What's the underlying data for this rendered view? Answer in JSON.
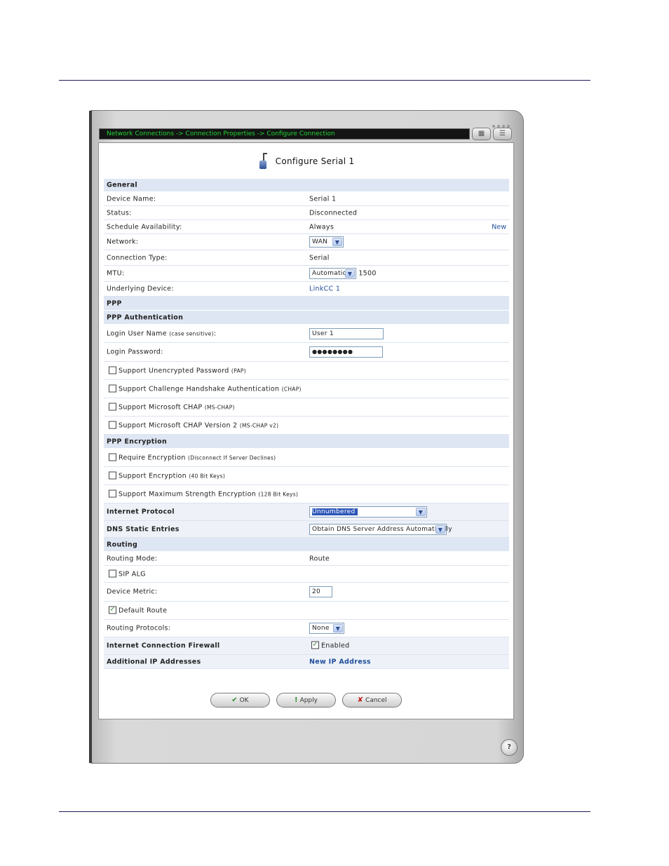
{
  "breadcrumb": "Network Connections -> Connection Properties -> Configure Connection",
  "title": "Configure Serial 1",
  "sections": {
    "general": "General",
    "ppp": "PPP",
    "ppp_auth": "PPP Authentication",
    "ppp_enc": "PPP Encryption",
    "routing": "Routing"
  },
  "general": {
    "device_name_label": "Device Name:",
    "device_name_value": "Serial 1",
    "status_label": "Status:",
    "status_value": "Disconnected",
    "schedule_label": "Schedule Availability:",
    "schedule_value": "Always",
    "schedule_new": "New",
    "network_label": "Network:",
    "network_value": "WAN",
    "conn_type_label": "Connection Type:",
    "conn_type_value": "Serial",
    "mtu_label": "MTU:",
    "mtu_mode": "Automatic",
    "mtu_value": "1500",
    "underlying_label": "Underlying Device:",
    "underlying_value": "LinkCC 1"
  },
  "auth": {
    "login_user_label": "Login User Name",
    "login_user_hint": "(case sensitive)",
    "login_user_colon": ":",
    "login_user_value": "User 1",
    "login_pass_label": "Login Password:",
    "login_pass_value": "●●●●●●●●",
    "pap_label": "Support Unencrypted Password",
    "pap_hint": "(PAP)",
    "chap_label": "Support Challenge Handshake Authentication",
    "chap_hint": "(CHAP)",
    "mschap_label": "Support Microsoft CHAP",
    "mschap_hint": "(MS-CHAP)",
    "mschap2_label": "Support Microsoft CHAP Version 2",
    "mschap2_hint": "(MS-CHAP v2)"
  },
  "encryption": {
    "require_label": "Require Encryption",
    "require_hint": "(Disconnect If Server Declines)",
    "support40_label": "Support Encryption",
    "support40_hint": "(40 Bit Keys)",
    "support128_label": "Support Maximum Strength Encryption",
    "support128_hint": "(128 Bit Keys)"
  },
  "ip": {
    "internet_protocol_label": "Internet Protocol",
    "internet_protocol_value": "Unnumbered",
    "dns_label": "DNS Static Entries",
    "dns_value": "Obtain DNS Server Address Automatically"
  },
  "routing": {
    "mode_label": "Routing Mode:",
    "mode_value": "Route",
    "sip_alg_label": "SIP ALG",
    "metric_label": "Device Metric:",
    "metric_value": "20",
    "default_route_label": "Default Route",
    "protocols_label": "Routing Protocols:",
    "protocols_value": "None",
    "firewall_label": "Internet Connection Firewall",
    "firewall_value": "Enabled",
    "additional_ip_label": "Additional IP Addresses",
    "additional_ip_link": "New IP Address"
  },
  "buttons": {
    "ok": "OK",
    "apply": "Apply",
    "cancel": "Cancel"
  },
  "help_glyph": "?",
  "checkbox_states": {
    "pap": false,
    "chap": false,
    "mschap": false,
    "mschap2": false,
    "require_enc": false,
    "support40": false,
    "support128": false,
    "sip_alg": false,
    "default_route": true,
    "firewall": true
  }
}
